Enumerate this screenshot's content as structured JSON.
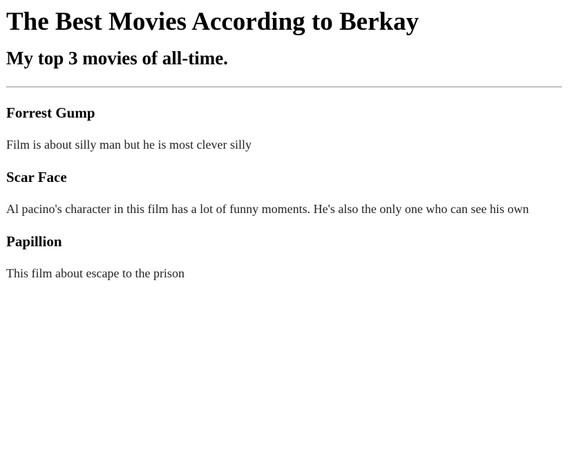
{
  "page": {
    "title": "The Best Movies According to Berkay",
    "subtitle": "My top 3 movies of all-time."
  },
  "movies": [
    {
      "title": "Forrest Gump",
      "description": "Film is about silly man but he is most clever silly"
    },
    {
      "title": "Scar Face",
      "description": "Al pacino's character in this film has a lot of funny moments. He's also the only one who can see his own"
    },
    {
      "title": "Papillion",
      "description": "This film about escape to the prison"
    }
  ]
}
